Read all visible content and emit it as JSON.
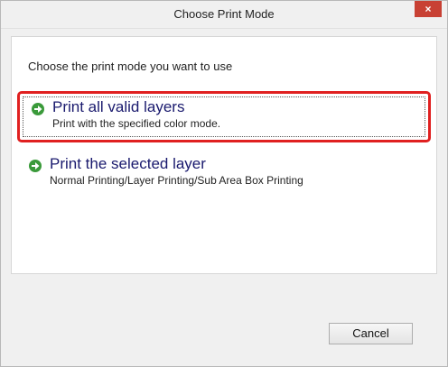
{
  "window": {
    "title": "Choose Print Mode",
    "close_label": "×"
  },
  "prompt": "Choose the print mode you want to use",
  "options": [
    {
      "title": "Print all valid layers",
      "description": "Print with the specified color mode.",
      "icon": "green-arrow-icon",
      "selected": true
    },
    {
      "title": "Print the selected layer",
      "description": "Normal Printing/Layer Printing/Sub Area Box Printing",
      "icon": "green-arrow-icon",
      "selected": false
    }
  ],
  "buttons": {
    "cancel_label": "Cancel"
  },
  "colors": {
    "highlight_border": "#e02020",
    "close_button": "#c84134",
    "option_title": "#1a1a6e",
    "arrow_icon": "#3a9a3a"
  }
}
